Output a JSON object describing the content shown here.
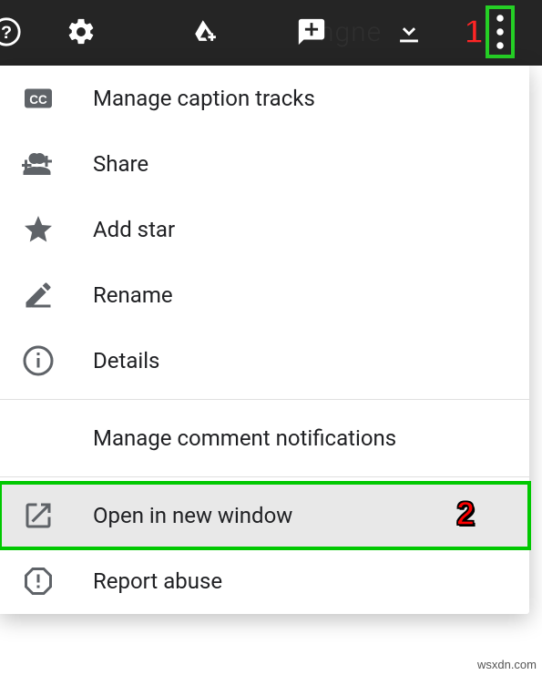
{
  "annotations": {
    "one": "1",
    "two": "2"
  },
  "topbar": {
    "bg_text": "ngne"
  },
  "menu": {
    "caption_tracks": "Manage caption tracks",
    "share": "Share",
    "add_star": "Add star",
    "rename": "Rename",
    "details": "Details",
    "comment_notifications": "Manage comment notifications",
    "open_new_window": "Open in new window",
    "report_abuse": "Report abuse"
  },
  "watermark": "wsxdn.com"
}
